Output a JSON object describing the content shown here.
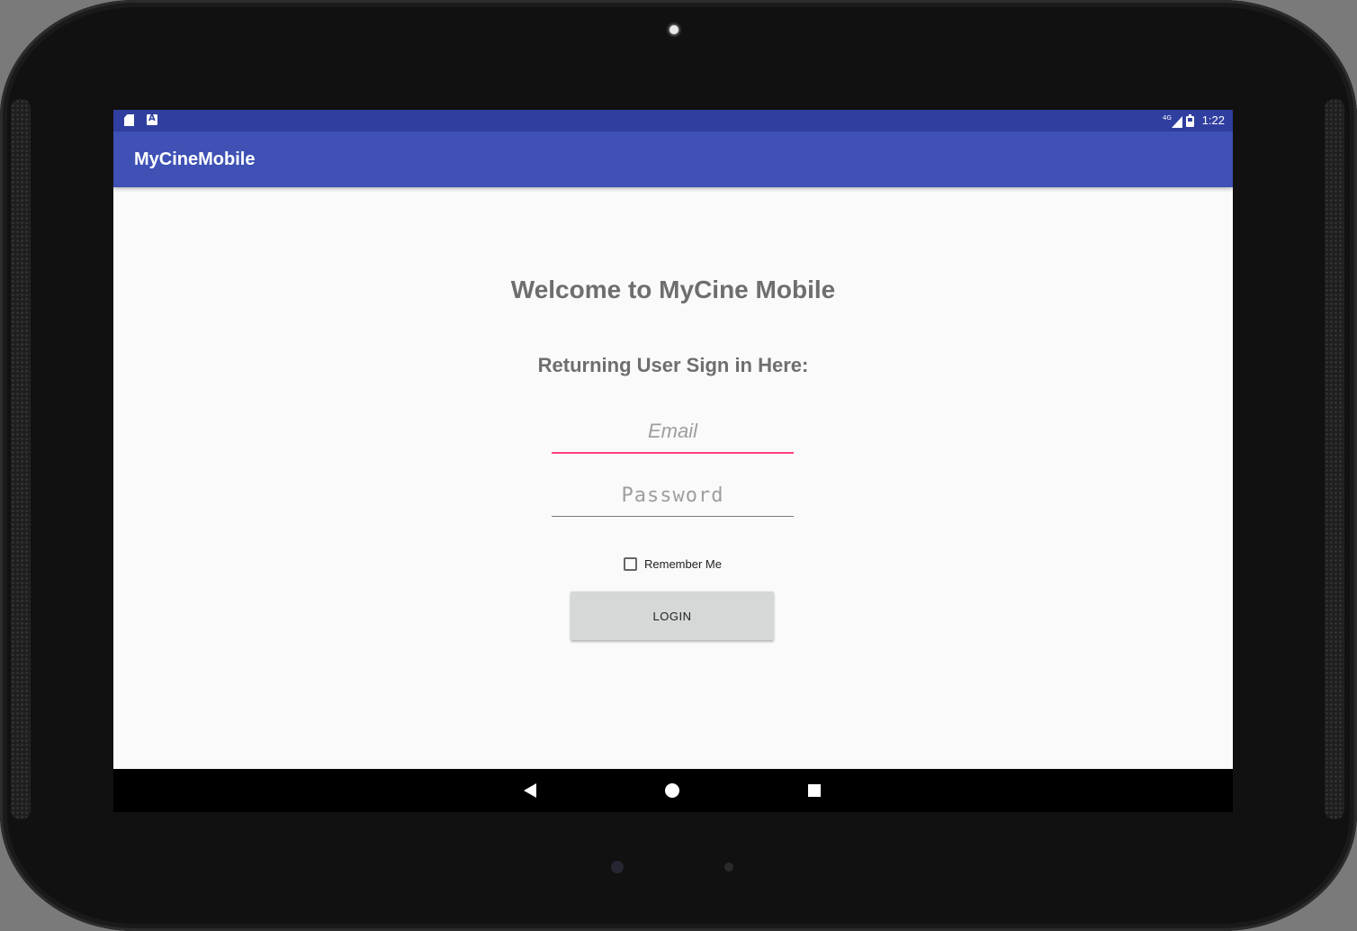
{
  "status_bar": {
    "time": "1:22",
    "network": "4G",
    "icons": [
      "sd-card-icon",
      "a-notification-icon",
      "signal-icon",
      "battery-icon"
    ]
  },
  "app_bar": {
    "title": "MyCineMobile"
  },
  "login": {
    "welcome": "Welcome to MyCine Mobile",
    "subtitle": "Returning User Sign in Here:",
    "email_placeholder": "Email",
    "email_value": "",
    "password_placeholder": "Password",
    "password_value": "",
    "remember_label": "Remember Me",
    "remember_checked": false,
    "login_label": "LOGIN"
  },
  "navigation": {
    "buttons": [
      "back-icon",
      "home-icon",
      "recents-icon"
    ]
  },
  "colors": {
    "status_bar": "#303f9f",
    "app_bar": "#3f51b5",
    "accent": "#ff4081",
    "background": "#fafafa",
    "heading_text": "#6e6e6e",
    "button": "#d6d7d7"
  }
}
